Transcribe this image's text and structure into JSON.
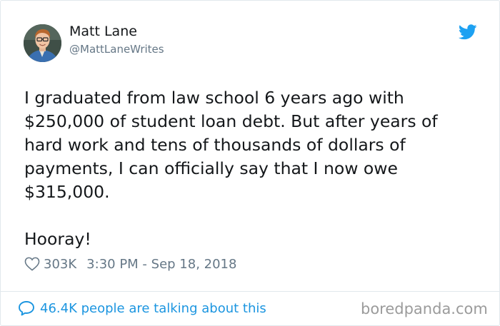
{
  "author": {
    "name": "Matt Lane",
    "handle": "@MattLaneWrites",
    "avatar_icon": "profile-photo"
  },
  "brand": {
    "icon": "twitter-bird-icon",
    "color": "#1da1f2"
  },
  "tweet": {
    "lines": [
      "I graduated from law school 6 years ago with",
      "$250,000 of student loan debt. But after years of",
      "hard work and tens of thousands of dollars of",
      "payments, I can officially say that I now owe",
      "$315,000."
    ],
    "closing": "Hooray!"
  },
  "meta": {
    "likes": "303K",
    "timestamp": "3:30 PM - Sep 18, 2018"
  },
  "footer": {
    "conversation_text": "46.4K people are talking about this",
    "link_color": "#1b95e0"
  },
  "watermark": "boredpanda.com"
}
